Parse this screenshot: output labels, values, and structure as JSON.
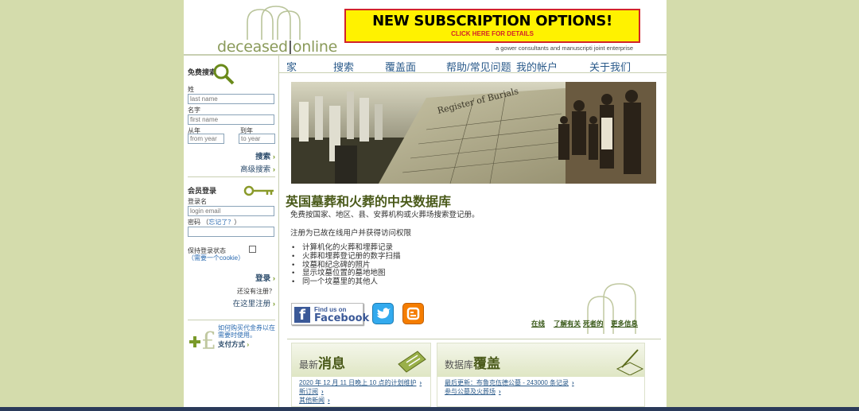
{
  "logo": {
    "part1": "deceased",
    "part2": "online"
  },
  "banner": {
    "title": "NEW SUBSCRIPTION OPTIONS!",
    "sub": "CLICK HERE FOR DETAILS"
  },
  "tagline": "a gower consultants and manuscripti joint enterprise",
  "nav": [
    "家",
    "搜索",
    "覆盖面",
    "帮助/常见问题",
    "我的帐户",
    "关于我们"
  ],
  "search": {
    "heading": "免费搜索",
    "surname_label": "姓",
    "surname_placeholder": "last name",
    "firstname_label": "名字",
    "firstname_placeholder": "first name",
    "from_label": "从年",
    "from_placeholder": "from year",
    "to_label": "到年",
    "to_placeholder": "to year",
    "search_link": "搜索",
    "advanced_link": "高级搜索"
  },
  "login": {
    "heading": "会员登录",
    "username_label": "登录名",
    "username_placeholder": "login email",
    "password_label": "密码 （",
    "forgot_link": "忘记了？",
    "forgot_close": "）",
    "remember_label": "保持登录状态",
    "cookie_note": "（需要一个cookie）",
    "login_link": "登录",
    "not_registered": "还没有注册？",
    "register_link": "在这里注册"
  },
  "voucher": {
    "text": "如何购买代金券以在需要时使用。",
    "pay_link": "支付方式"
  },
  "main": {
    "title": "英国墓葬和火葬的中央数据库",
    "intro": "免费按国家、地区、县、安葬机构或火葬场搜索登记册。",
    "register_note": "注册为已故在线用户并获得访问权限",
    "bullets": [
      "计算机化的火葬和埋葬记录",
      "火葬和埋葬登记册的数字扫描",
      "坟墓和纪念碑的照片",
      "显示坟墓位置的墓地地图",
      "同一个坟墓里的其他人"
    ]
  },
  "social": {
    "fb_find": "Find us on",
    "fb_name": "Facebook"
  },
  "quick_links": [
    "在线",
    "了解有关",
    "死者的",
    "更多信息"
  ],
  "news": {
    "title_small": "最新",
    "title_big": "消息",
    "links": [
      "2020 年 12 月 11 日晚上 10 点的计划维护",
      "新订阅",
      "其他新闻"
    ]
  },
  "coverage": {
    "title_small": "数据库",
    "title_big": "覆盖",
    "links": [
      "最后更新：布鲁克伍德公墓 - 243000 条记录",
      "参与公墓及火葬场"
    ]
  },
  "colors": {
    "background": "#d4dcac",
    "accent": "#4a5a1a",
    "banner_bg": "#fff200",
    "banner_border": "#d2232a"
  }
}
